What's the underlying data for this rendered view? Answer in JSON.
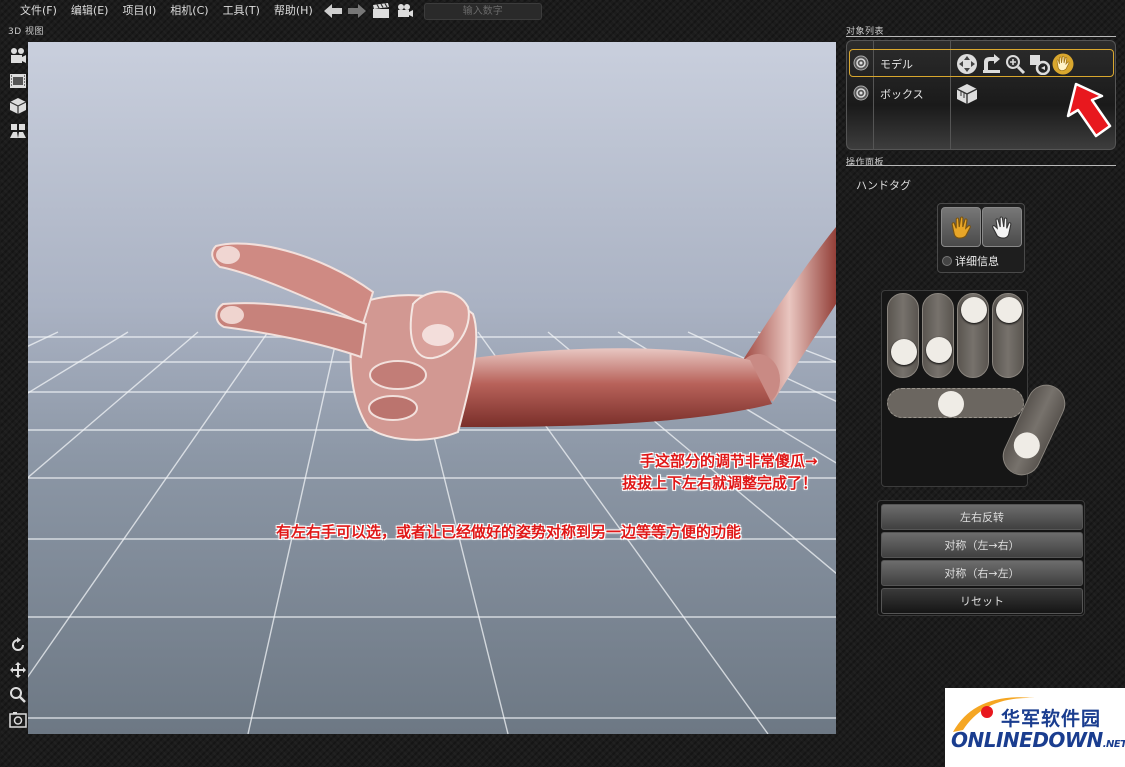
{
  "menu": {
    "items": [
      "文件(F)",
      "编辑(E)",
      "项目(I)",
      "相机(C)",
      "工具(T)",
      "帮助(H)"
    ],
    "number_input_placeholder": "输入数字"
  },
  "viewport": {
    "label": "3D 视图"
  },
  "object_list": {
    "title": "对象列表",
    "items": [
      {
        "label": "モデル",
        "selected": true,
        "icons": [
          "move-icon",
          "rotate-icon",
          "zoom-icon",
          "reset-icon",
          "hand-icon"
        ]
      },
      {
        "label": "ボックス",
        "selected": false,
        "icons": [
          "box-icon"
        ]
      }
    ]
  },
  "operation_panel": {
    "title": "操作面板",
    "subtitle": "ハンドタグ",
    "detail_label": "详细信息",
    "finger_levels": [
      0.2,
      0.25,
      1.0,
      1.0
    ],
    "palm_level": 0.45,
    "thumb_level": 0.25,
    "buttons": [
      "左右反转",
      "对称（左→右）",
      "对称（右→左）",
      "リセット"
    ]
  },
  "annotations": {
    "line1": "手这部分的调节非常傻瓜→",
    "line2": "拔拔上下左右就调整完成了！",
    "line3": "有左右手可以选，或者让已经做好的姿势对称到另一边等等方便的功能"
  },
  "watermark": {
    "cn": "华军软件园",
    "en": "ONLINEDOWN",
    "suffix": ".NET"
  },
  "colors": {
    "accent_gold": "#d9a72e",
    "annotation_red": "#e01818",
    "arrow_red": "#e8181e",
    "logo_blue": "#1a3d8f"
  }
}
